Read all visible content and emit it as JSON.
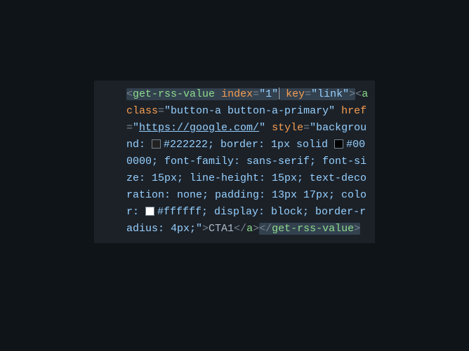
{
  "code": {
    "outerTag": "get-rss-value",
    "outerAttrs": [
      {
        "name": "index",
        "value": "\"1\""
      },
      {
        "name": "key",
        "value": "\"link\""
      }
    ],
    "innerTag": "a",
    "innerAttrs": {
      "class_name": "class",
      "class_value": "\"button-a button-a-primary\"",
      "href_name": "href",
      "href_value_open": "\"",
      "href_url": "https://google.com/",
      "href_value_close": "\"",
      "style_name": "style",
      "style_value_open": "\"",
      "style_decl_1a": "background: ",
      "style_color_1": "#222222",
      "style_decl_1b": "; border: 1px solid ",
      "style_color_2": "#000000",
      "style_decl_2": "; font-family: sans-serif; font-size: 15px; line-height: 15px; text-decoration: none; padding: 13px 17px; color: ",
      "style_color_3": "#ffffff",
      "style_decl_3": "; display: block; border-radius: 4px;\"",
      "text": "CTA1"
    },
    "swatches": {
      "c1": "#222222",
      "c2": "#000000",
      "c3": "#ffffff"
    }
  }
}
